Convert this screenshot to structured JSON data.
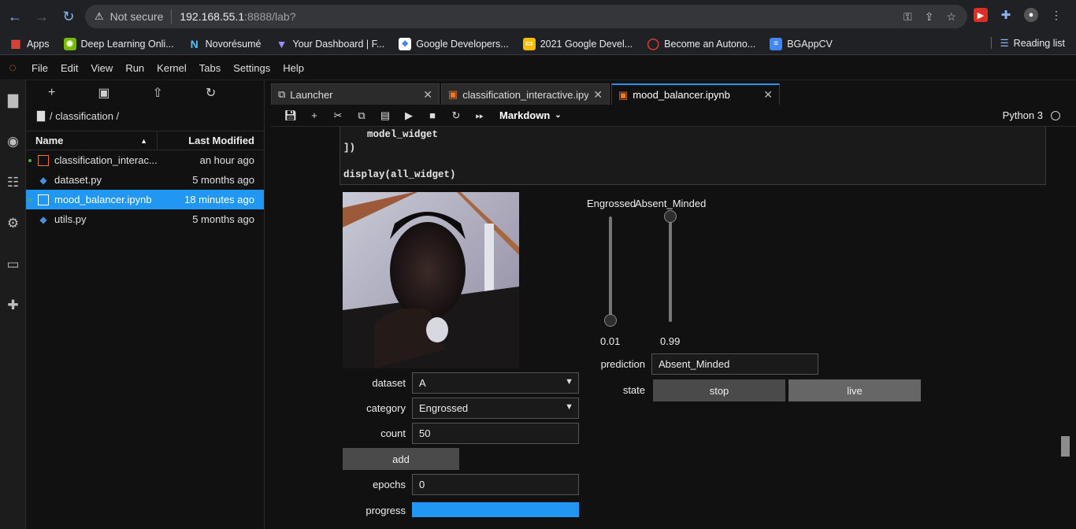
{
  "browser": {
    "security": "Not secure",
    "url_host": "192.168.55.1",
    "url_path": ":8888/lab?",
    "bookmarks": [
      {
        "label": "Apps",
        "color": "#e8453c",
        "glyph": "⋮"
      },
      {
        "label": "Deep Learning Onli...",
        "color": "#76b900",
        "glyph": "◉"
      },
      {
        "label": "Novorésumé",
        "color": "#0e2a47",
        "glyph": "N"
      },
      {
        "label": "Your Dashboard | F...",
        "color": "#7b61ff",
        "glyph": "▼"
      },
      {
        "label": "Google Developers...",
        "color": "#4285f4",
        "glyph": "◆"
      },
      {
        "label": "2021 Google Devel...",
        "color": "#fbbc04",
        "glyph": "▭"
      },
      {
        "label": "Become an Autono...",
        "color": "#e53935",
        "glyph": "◯"
      },
      {
        "label": "BGAppCV",
        "color": "#4285f4",
        "glyph": "≡"
      }
    ],
    "reading_list": "Reading list"
  },
  "menu": [
    "File",
    "Edit",
    "View",
    "Run",
    "Kernel",
    "Tabs",
    "Settings",
    "Help"
  ],
  "filebrowser": {
    "breadcrumb": "/ classification /",
    "col_name": "Name",
    "col_modified": "Last Modified",
    "files": [
      {
        "name": "classification_interac...",
        "modified": "an hour ago",
        "type": "notebook",
        "running": true
      },
      {
        "name": "dataset.py",
        "modified": "5 months ago",
        "type": "python",
        "running": false
      },
      {
        "name": "mood_balancer.ipynb",
        "modified": "18 minutes ago",
        "type": "notebook",
        "running": true,
        "selected": true
      },
      {
        "name": "utils.py",
        "modified": "5 months ago",
        "type": "python",
        "running": false
      }
    ]
  },
  "tabs": [
    {
      "label": "Launcher"
    },
    {
      "label": "classification_interactive.ipyn"
    },
    {
      "label": "mood_balancer.ipynb"
    }
  ],
  "toolbar": {
    "cell_type": "Markdown",
    "kernel": "Python 3"
  },
  "code": {
    "line1": "    model_widget",
    "line2": "])",
    "line3": "",
    "line4": "display(all_widget)"
  },
  "widgets": {
    "dataset_label": "dataset",
    "dataset_value": "A",
    "category_label": "category",
    "category_value": "Engrossed",
    "count_label": "count",
    "count_value": "50",
    "add_label": "add",
    "epochs_label": "epochs",
    "epochs_value": "0",
    "progress_label": "progress",
    "progress_value": 1.0,
    "slider1_label": "Engrossed",
    "slider1_value": "0.01",
    "slider2_label": "Absent_Minded",
    "slider2_value": "0.99",
    "prediction_label": "prediction",
    "prediction_value": "Absent_Minded",
    "state_label": "state",
    "stop_label": "stop",
    "live_label": "live"
  }
}
